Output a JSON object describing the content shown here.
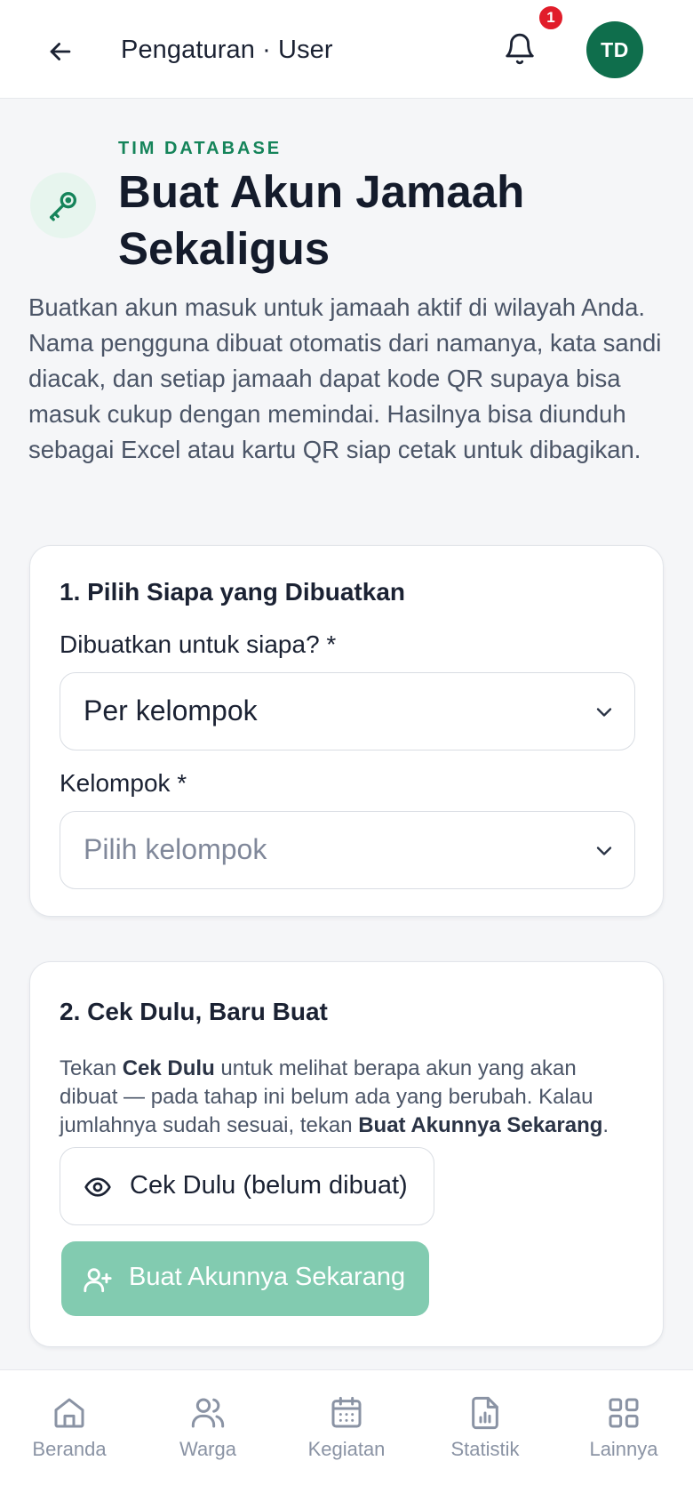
{
  "topbar": {
    "title": "Pengaturan · User",
    "notification_count": "1",
    "avatar_initials": "TD"
  },
  "header": {
    "eyebrow": "TIM DATABASE",
    "title": "Buat Akun Jamaah Sekaligus",
    "intro": "Buatkan akun masuk untuk jamaah aktif di wilayah Anda. Nama pengguna dibuat otomatis dari namanya, kata sandi diacak, dan setiap jamaah dapat kode QR supaya bisa masuk cukup dengan memindai. Hasilnya bisa diunduh sebagai Excel atau kartu QR siap cetak untuk dibagikan.",
    "icon": "key-icon"
  },
  "step1": {
    "title": "1. Pilih Siapa yang Dibuatkan",
    "target_label": "Dibuatkan untuk siapa? *",
    "target_value": "Per kelompok",
    "group_label": "Kelompok *",
    "group_placeholder": "Pilih kelompok"
  },
  "step2": {
    "title": "2. Cek Dulu, Baru Buat",
    "help_1": "Tekan ",
    "help_bold_1": "Cek Dulu",
    "help_2": " untuk melihat berapa akun yang akan dibuat — pada tahap ini belum ada yang berubah. Kalau jumlahnya sudah sesuai, tekan ",
    "help_bold_2": "Buat Akunnya Sekarang",
    "help_3": ".",
    "preview_button": "Cek Dulu (belum dibuat)",
    "create_button": "Buat Akunnya Sekarang"
  },
  "bottom_nav": [
    {
      "label": "Beranda",
      "icon": "home-icon"
    },
    {
      "label": "Warga",
      "icon": "users-icon"
    },
    {
      "label": "Kegiatan",
      "icon": "calendar-icon"
    },
    {
      "label": "Statistik",
      "icon": "report-icon"
    },
    {
      "label": "Lainnya",
      "icon": "grid-icon"
    }
  ],
  "colors": {
    "brand": "#0f6e4c",
    "accent": "#15845a",
    "primary_disabled": "#82cbb0",
    "badge": "#e11d2a"
  }
}
